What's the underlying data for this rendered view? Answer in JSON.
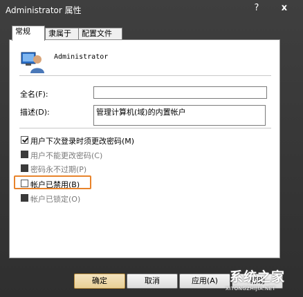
{
  "window": {
    "title": "Administrator 属性",
    "help_label": "?",
    "close_label": "x"
  },
  "tabs": [
    {
      "label": "常规"
    },
    {
      "label": "隶属于"
    },
    {
      "label": "配置文件"
    }
  ],
  "general": {
    "user_name": "Administrator",
    "fullname_label": "全名(F):",
    "fullname_value": "",
    "description_label": "描述(D):",
    "description_value": "管理计算机(域)的内置帐户",
    "checkboxes": [
      {
        "label": "用户下次登录时须更改密码(M)",
        "state": "checked"
      },
      {
        "label": "用户不能更改密码(C)",
        "state": "indeterminate"
      },
      {
        "label": "密码永不过期(P)",
        "state": "indeterminate"
      },
      {
        "label": "帐户已禁用(B)",
        "state": "unchecked"
      },
      {
        "label": "帐户已锁定(O)",
        "state": "indeterminate"
      }
    ]
  },
  "buttons": {
    "ok": "确定",
    "cancel": "取消",
    "apply": "应用(A)",
    "help": "帮助"
  },
  "watermark": {
    "text": "系统之家",
    "url": "XITONGZHIJIA.NET"
  },
  "colors": {
    "highlight": "#e8832a",
    "ok_button": "#e8cf96"
  }
}
